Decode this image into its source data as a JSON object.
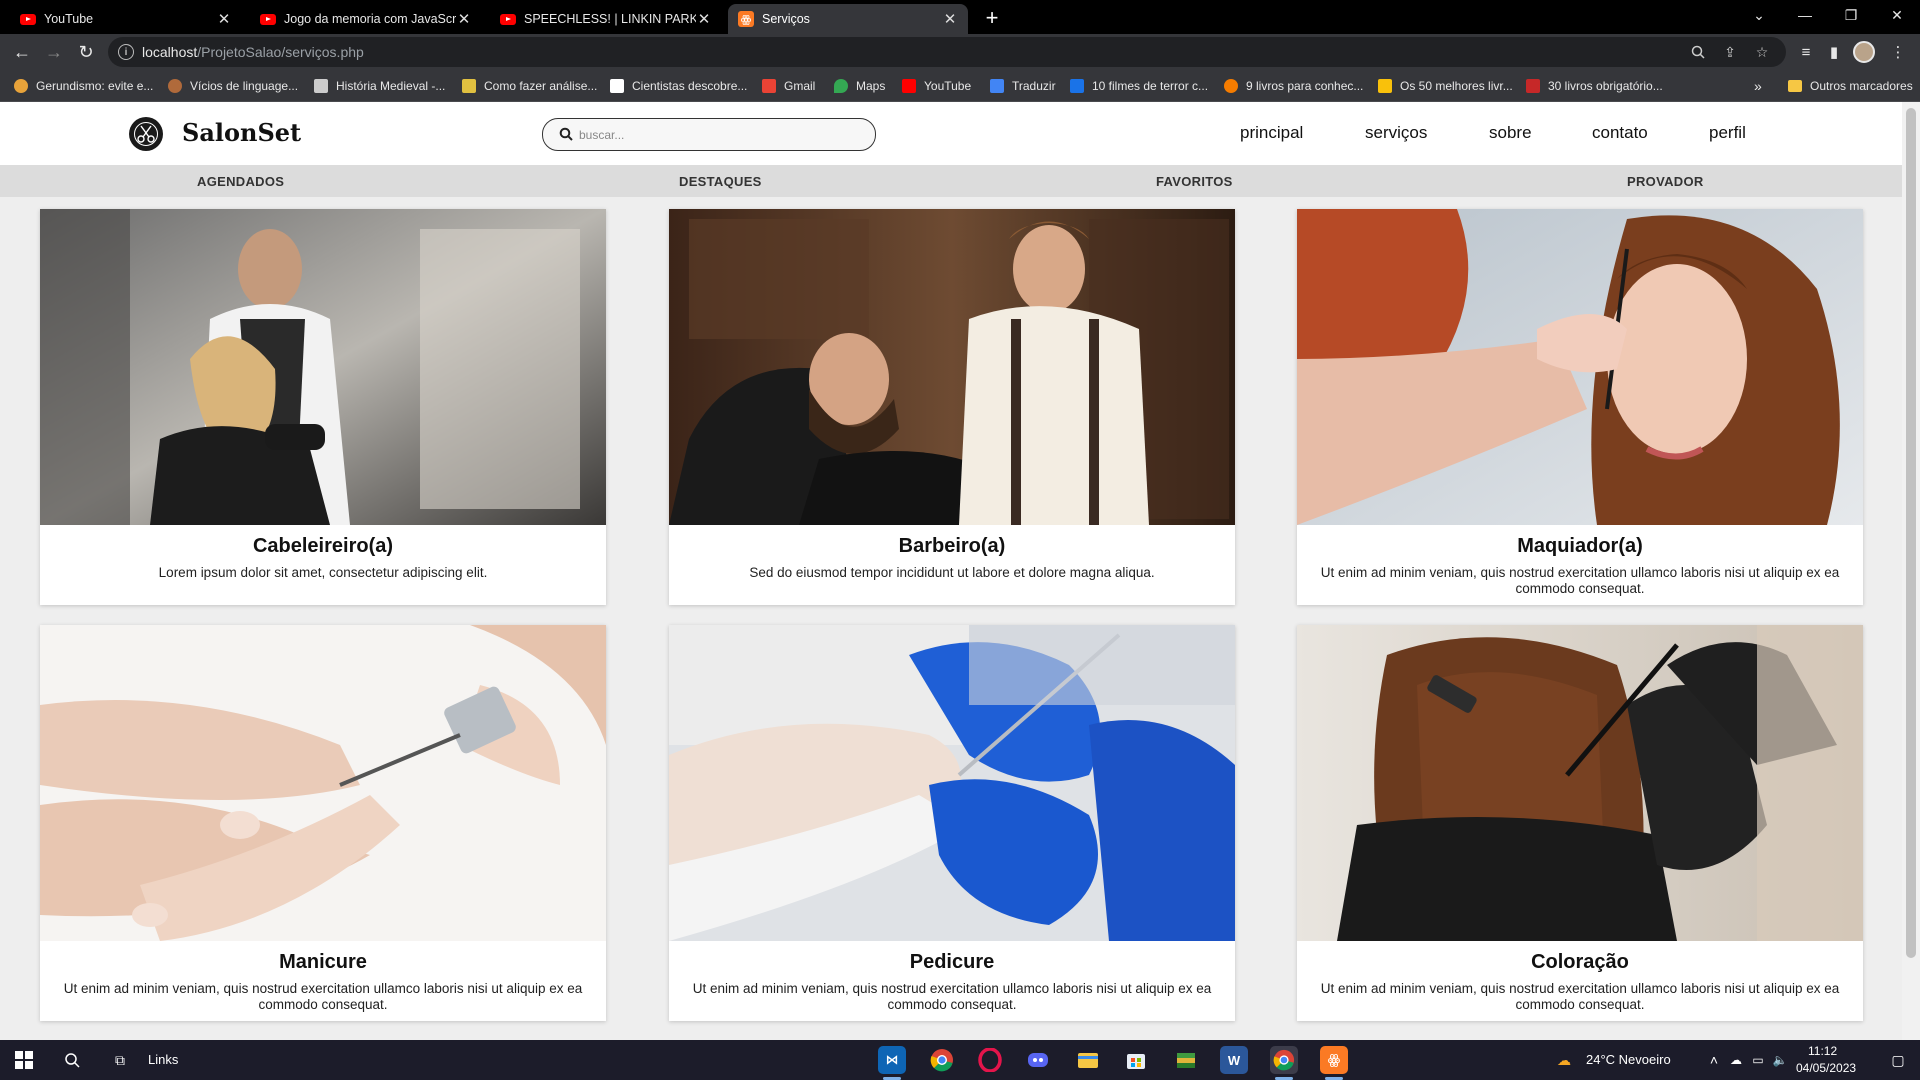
{
  "browser": {
    "tabs": [
      {
        "title": "YouTube",
        "icon": "youtube-icon",
        "active": false
      },
      {
        "title": "Jogo da memoria com JavaScript",
        "icon": "youtube-icon",
        "active": false
      },
      {
        "title": "SPEECHLESS! | LINKIN PARK - FIG",
        "icon": "youtube-icon",
        "active": false
      },
      {
        "title": "Serviços",
        "icon": "xampp-icon",
        "active": true
      }
    ],
    "url_host": "localhost",
    "url_path": "/ProjetoSalao/serviços.php",
    "bookmarks": [
      {
        "label": "Gerundismo: evite e...",
        "icon": "globe-icon",
        "color": "#e8a33a"
      },
      {
        "label": "Vícios de linguage...",
        "icon": "site-icon",
        "color": "#b06a3b"
      },
      {
        "label": "História Medieval -...",
        "icon": "site-icon",
        "color": "#cccccc"
      },
      {
        "label": "Como fazer análise...",
        "icon": "site-icon",
        "color": "#e0c040"
      },
      {
        "label": "Cientistas descobre...",
        "icon": "site-icon",
        "color": "#ffffff"
      },
      {
        "label": "Gmail",
        "icon": "gmail-icon",
        "color": "#ea4335"
      },
      {
        "label": "Maps",
        "icon": "maps-icon",
        "color": "#34a853"
      },
      {
        "label": "YouTube",
        "icon": "youtube-icon",
        "color": "#ff0000"
      },
      {
        "label": "Traduzir",
        "icon": "translate-icon",
        "color": "#4285f4"
      },
      {
        "label": "10 filmes de terror c...",
        "icon": "site-icon",
        "color": "#1a73e8"
      },
      {
        "label": "9 livros para conhec...",
        "icon": "site-icon",
        "color": "#f57c00"
      },
      {
        "label": "Os 50 melhores livr...",
        "icon": "site-icon",
        "color": "#f9c10b"
      },
      {
        "label": "30 livros obrigatório...",
        "icon": "site-icon",
        "color": "#c62828"
      }
    ],
    "other_bookmarks": "Outros marcadores"
  },
  "site": {
    "brand": "SalonSet",
    "search_placeholder": "buscar...",
    "nav": [
      "principal",
      "serviços",
      "sobre",
      "contato",
      "perfil"
    ],
    "subnav": [
      "AGENDADOS",
      "DESTAQUES",
      "FAVORITOS",
      "PROVADOR"
    ],
    "cards": [
      {
        "title": "Cabeleireiro(a)",
        "desc": "Lorem ipsum dolor sit amet, consectetur adipiscing elit."
      },
      {
        "title": "Barbeiro(a)",
        "desc": "Sed do eiusmod tempor incididunt ut labore et dolore magna aliqua."
      },
      {
        "title": "Maquiador(a)",
        "desc": "Ut enim ad minim veniam, quis nostrud exercitation ullamco laboris nisi ut aliquip ex ea commodo consequat."
      },
      {
        "title": "Manicure",
        "desc": "Ut enim ad minim veniam, quis nostrud exercitation ullamco laboris nisi ut aliquip ex ea commodo consequat."
      },
      {
        "title": "Pedicure",
        "desc": "Ut enim ad minim veniam, quis nostrud exercitation ullamco laboris nisi ut aliquip ex ea commodo consequat."
      },
      {
        "title": "Coloração",
        "desc": "Ut enim ad minim veniam, quis nostrud exercitation ullamco laboris nisi ut aliquip ex ea commodo consequat."
      }
    ]
  },
  "taskbar": {
    "search_label": "Links",
    "weather": "24°C  Nevoeiro",
    "time": "11:12",
    "date": "04/05/2023"
  }
}
